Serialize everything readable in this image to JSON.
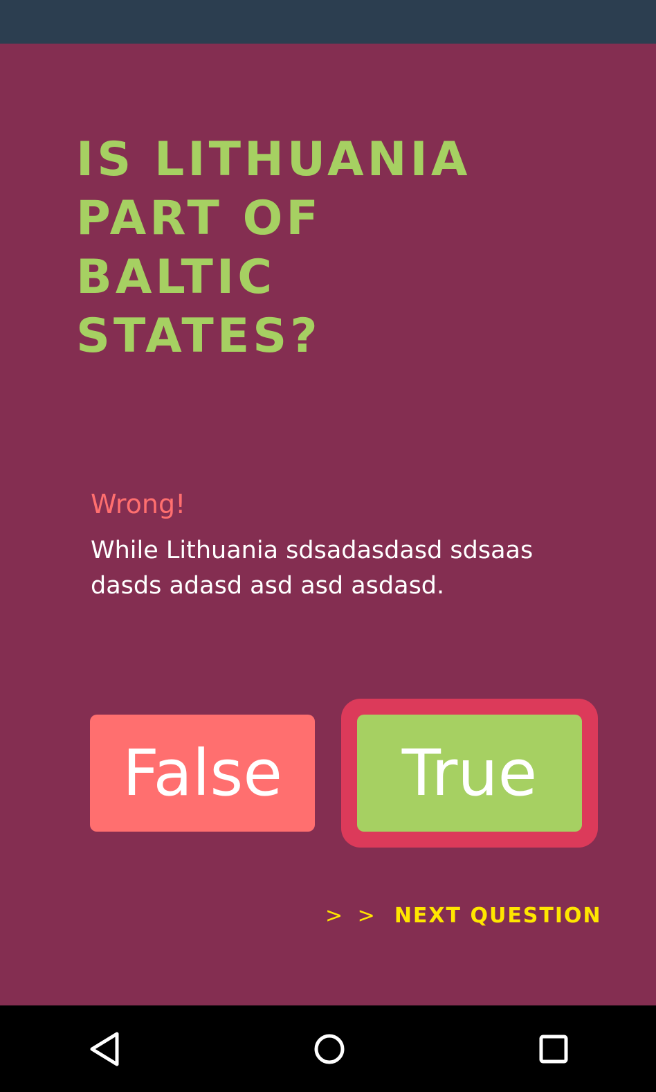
{
  "question": {
    "text": "IS LITHUANIA PART OF BALTIC STATES?"
  },
  "feedback": {
    "status": "Wrong!",
    "explanation": "While Lithuania sdsadasdasd sdsaas dasds adasd asd asd asdasd."
  },
  "answers": {
    "false_label": "False",
    "true_label": "True",
    "selected": "true"
  },
  "next": {
    "chevrons": "> >",
    "label": "NEXT QUESTION"
  },
  "colors": {
    "status_bar": "#2c3e50",
    "background": "#842e51",
    "question": "#a6d062",
    "wrong": "#ff6f6f",
    "false_button": "#ff6f6f",
    "true_button": "#a6d062",
    "selected_ring": "#dc3a5a",
    "next_link": "#ffe600"
  },
  "navigation": {
    "back_icon": "back-triangle-icon",
    "home_icon": "home-circle-icon",
    "recents_icon": "recents-square-icon"
  }
}
